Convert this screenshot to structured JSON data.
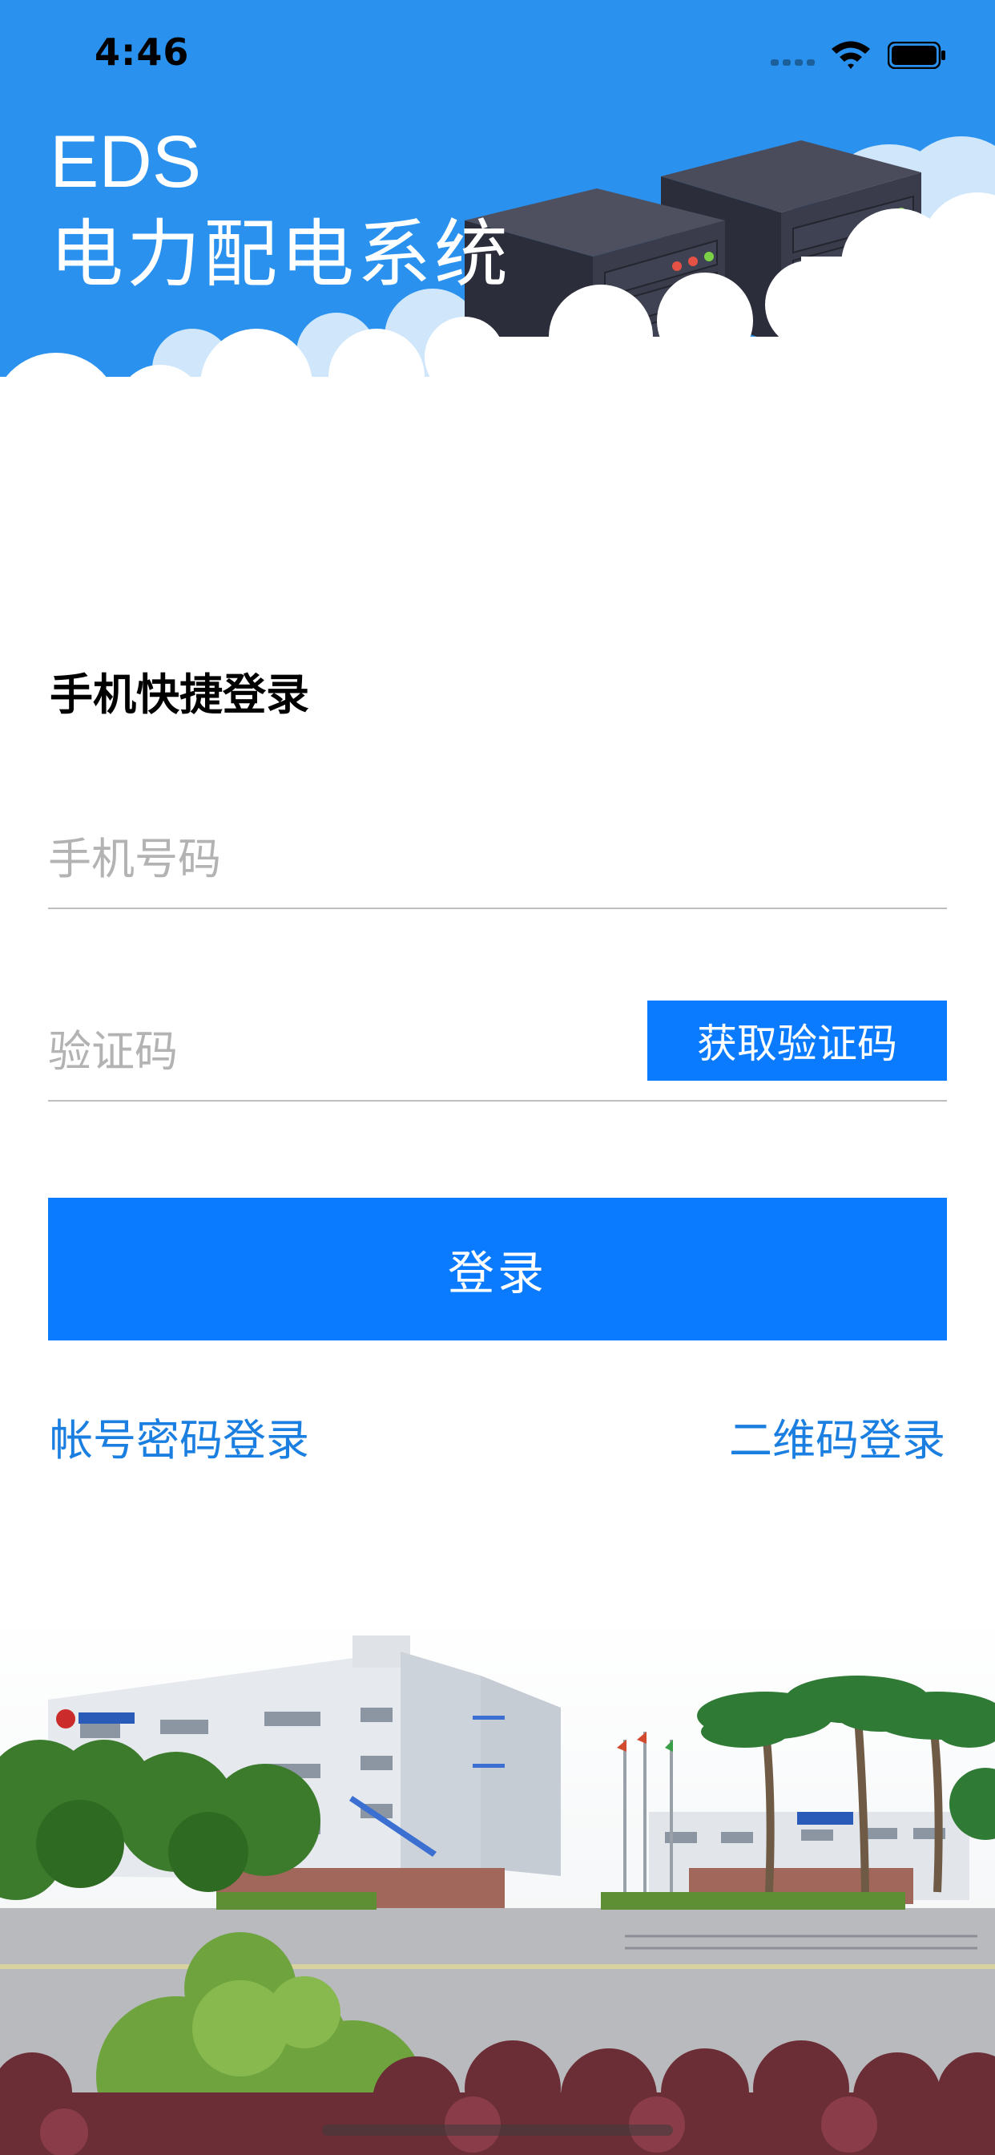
{
  "status_bar": {
    "time": "4:46"
  },
  "header": {
    "title_line1": "EDS",
    "title_line2": "电力配电系统",
    "background_color": "#2990ec"
  },
  "form": {
    "title": "手机快捷登录",
    "phone_placeholder": "手机号码",
    "code_placeholder": "验证码",
    "get_code_label": "获取验证码",
    "login_label": "登录"
  },
  "links": {
    "account_login": "帐号密码登录",
    "qr_login": "二维码登录"
  },
  "colors": {
    "accent": "#0a7bff",
    "link": "#1a7fe0",
    "header_blue": "#2990ec"
  },
  "icons": [
    "wifi-icon",
    "battery-icon",
    "server-illustration",
    "cloud-illustration"
  ]
}
